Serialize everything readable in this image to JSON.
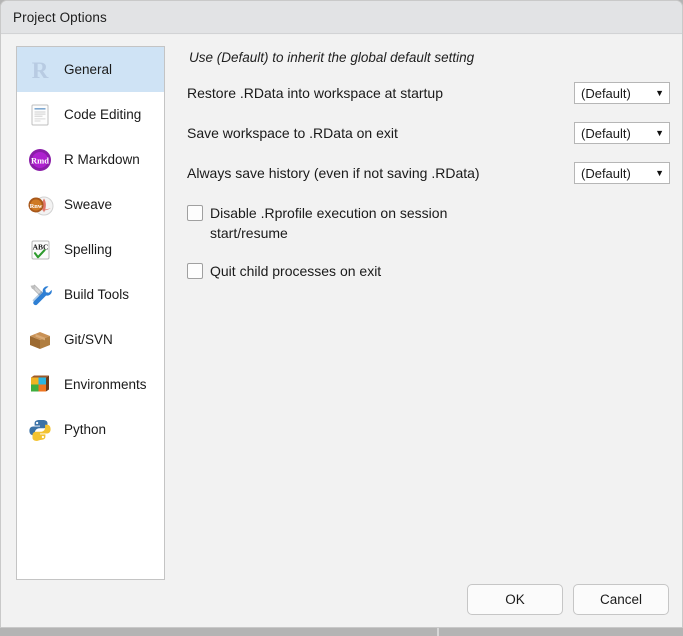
{
  "window": {
    "title": "Project Options"
  },
  "sidebar": {
    "items": [
      {
        "label": "General",
        "icon": "r-logo-icon",
        "selected": true
      },
      {
        "label": "Code Editing",
        "icon": "document-icon",
        "selected": false
      },
      {
        "label": "R Markdown",
        "icon": "rmd-badge-icon",
        "selected": false
      },
      {
        "label": "Sweave",
        "icon": "rnw-pdf-icon",
        "selected": false
      },
      {
        "label": "Spelling",
        "icon": "abc-check-icon",
        "selected": false
      },
      {
        "label": "Build Tools",
        "icon": "wrench-tools-icon",
        "selected": false
      },
      {
        "label": "Git/SVN",
        "icon": "package-box-icon",
        "selected": false
      },
      {
        "label": "Environments",
        "icon": "color-cube-icon",
        "selected": false
      },
      {
        "label": "Python",
        "icon": "python-icon",
        "selected": false
      }
    ]
  },
  "main": {
    "hint": "Use (Default) to inherit the global default setting",
    "options": [
      {
        "label": "Restore .RData into workspace at startup",
        "value": "(Default)"
      },
      {
        "label": "Save workspace to .RData on exit",
        "value": "(Default)"
      },
      {
        "label": "Always save history (even if not saving .RData)",
        "value": "(Default)"
      }
    ],
    "checkboxes": [
      {
        "label": "Disable .Rprofile execution on session start/resume",
        "checked": false
      },
      {
        "label": "Quit child processes on exit",
        "checked": false
      }
    ]
  },
  "footer": {
    "ok_label": "OK",
    "cancel_label": "Cancel"
  },
  "colors": {
    "selection": "#cfe3f5",
    "titlebar": "#e2e3e5",
    "pane": "#f2f2f2"
  }
}
